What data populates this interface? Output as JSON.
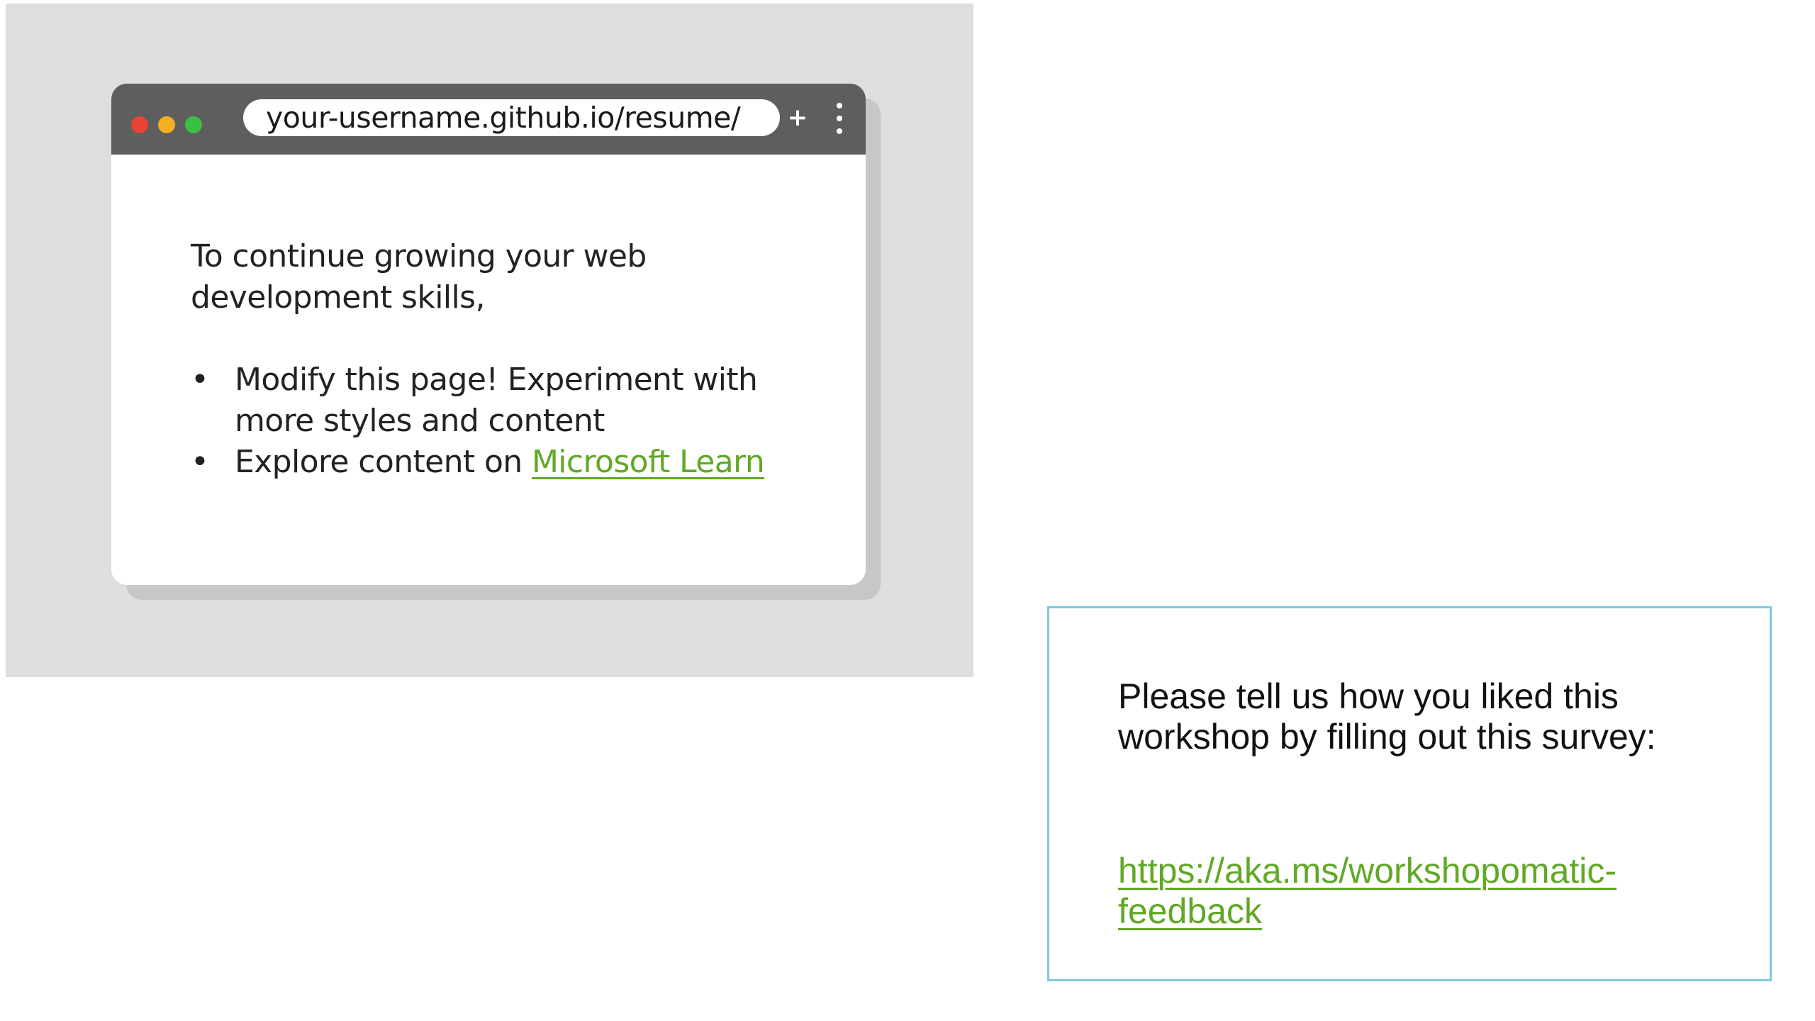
{
  "browser_mockup": {
    "url": "your-username.github.io/resume/",
    "new_tab_symbol": "+",
    "window_controls": [
      "close-dot",
      "minimize-dot",
      "maximize-dot"
    ],
    "menu_icon": "kebab-menu-icon",
    "content": {
      "intro": "To continue growing your web development skills,",
      "bullet_symbol": "•",
      "tips": [
        {
          "text": "Modify this page! Experiment with more styles and content"
        },
        {
          "text": "Explore content on ",
          "link_text": "Microsoft Learn"
        }
      ]
    }
  },
  "survey": {
    "text": "Please tell us how you liked this workshop by filling out this survey:",
    "link_text": "https://aka.ms/workshopomatic-feedback"
  },
  "colors": {
    "panel_background": "#dedede",
    "titlebar": "#5e5e5e",
    "dot_red": "#e94335",
    "dot_yellow": "#f5ae1f",
    "dot_green": "#39c043",
    "link_green": "#60a826",
    "survey_border": "#7fc8df"
  }
}
